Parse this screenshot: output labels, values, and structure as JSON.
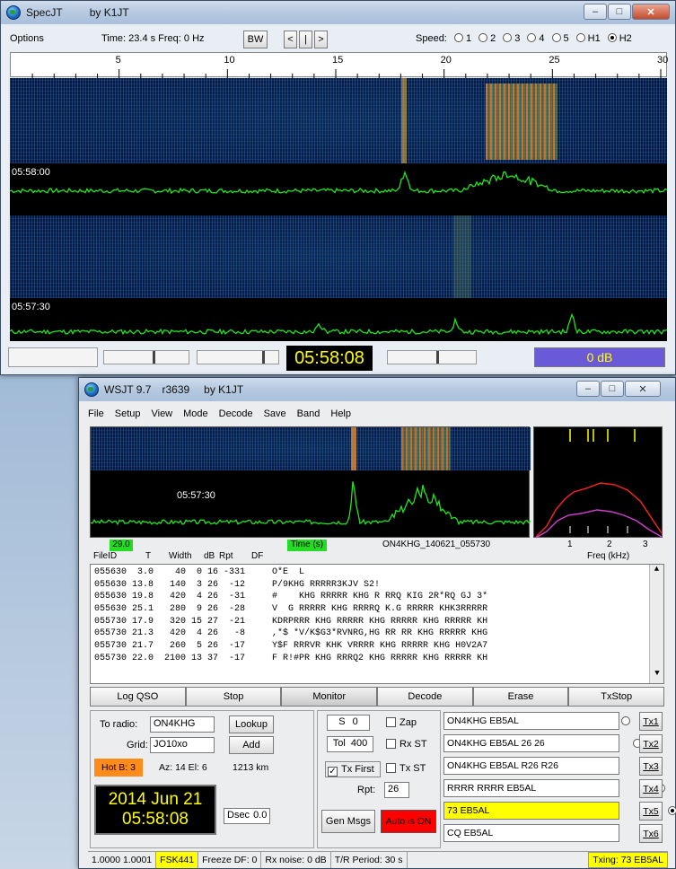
{
  "specjt": {
    "title": "SpecJT",
    "author": "by K1JT",
    "options_label": "Options",
    "time_readout": "Time: 23.4 s  Freq: 0 Hz",
    "bw_label": "BW",
    "nav_prev": "<",
    "nav_mid": "|",
    "nav_next": ">",
    "speed_label": "Speed:",
    "speed_options": [
      "1",
      "2",
      "3",
      "4",
      "5",
      "H1",
      "H2"
    ],
    "speed_selected": "H2",
    "scale_ticks": [
      "5",
      "10",
      "15",
      "20",
      "25",
      "30"
    ],
    "label_top": "05:58:00",
    "label_bottom": "05:57:30",
    "clock": "05:58:08",
    "db_readout": "0 dB"
  },
  "wsjt": {
    "title": "WSJT 9.7",
    "revision": "r3639",
    "author": "by K1JT",
    "menu": [
      "File",
      "Setup",
      "View",
      "Mode",
      "Decode",
      "Save",
      "Band",
      "Help"
    ],
    "plot_time_label": "05:57:30",
    "info_bar": {
      "value_left": "29.0",
      "time_label": "Time (s)",
      "filename": "ON4KHG_140621_055730",
      "freq_ticks": [
        "1",
        "2",
        "3"
      ],
      "freq_label": "Freq (kHz)"
    },
    "decode_header": [
      "FileID",
      "T",
      "Width",
      "dB",
      "Rpt",
      "DF"
    ],
    "decode_rows": [
      "055630  3.0    40  0 16 -331     O*E  L",
      "055630 13.8   140  3 26  -12     P/9KHG RRRRR3KJV S2!",
      "055630 19.8   420  4 26  -31     #    KHG RRRRR KHG R RRQ KIG 2R*RQ GJ 3*",
      "055630 25.1   280  9 26  -28     V  G RRRRR KHG RRRRQ K.G RRRRR KHK3RRRRR",
      "055730 17.9   320 15 27  -21     KDRPRRR KHG RRRRR KHG RRRRR KHG RRRRR KH",
      "055730 21.3   420  4 26   -8     ,*$ *V/K$G3*RVNRG,HG RR RR KHG RRRRR KHG",
      "055730 21.7   260  5 26  -17     Y$F RRRVR KHK VRRRR KHG RRRRR KHG H0V2A7",
      "055730 22.0  2100 13 37  -17     F R!#PR KHG RRRQ2 KHG RRRRR KHG RRRRR KH"
    ],
    "buttons": [
      "Log QSO",
      "Stop",
      "Monitor",
      "Decode",
      "Erase",
      "TxStop"
    ],
    "to_radio_label": "To radio:",
    "to_radio_value": "ON4KHG",
    "lookup_label": "Lookup",
    "grid_label": "Grid:",
    "grid_value": "JO10xo",
    "add_label": "Add",
    "hotb_label": "Hot B: 3",
    "az_el": "Az: 14   El: 6",
    "distance": "1213 km",
    "date": "2014 Jun 21",
    "time": "05:58:08",
    "dsec_label": "Dsec",
    "dsec_value": "0.0",
    "s_label": "S",
    "s_value": "0",
    "zap_label": "Zap",
    "tol_label": "Tol",
    "tol_value": "400",
    "rxst_label": "Rx ST",
    "txfirst_label": "Tx First",
    "txst_label": "Tx ST",
    "rpt_label": "Rpt:",
    "rpt_value": "26",
    "genmsgs_label": "Gen Msgs",
    "auto_label": "Auto is  ON",
    "tx_messages": [
      {
        "text": "ON4KHG EB5AL",
        "btn": "Tx1",
        "selected": false
      },
      {
        "text": "ON4KHG EB5AL 26 26",
        "btn": "Tx2",
        "selected": false
      },
      {
        "text": "ON4KHG EB5AL R26 R26",
        "btn": "Tx3",
        "selected": false
      },
      {
        "text": "RRRR RRRR EB5AL",
        "btn": "Tx4",
        "selected": false
      },
      {
        "text": "73 EB5AL",
        "btn": "Tx5",
        "selected": true
      },
      {
        "text": "CQ EB5AL",
        "btn": "Tx6",
        "selected": false
      }
    ],
    "status": {
      "ratio": "1.0000 1.0001",
      "mode": "FSK441",
      "freeze": "Freeze DF:   0",
      "rx_noise": "Rx noise:  0 dB",
      "tr_period": "T/R Period: 30 s",
      "txing": "Txing:  73 EB5AL"
    }
  },
  "colors": {
    "trace": "#22e51e",
    "yellow": "#ffff00",
    "red": "#ff0000",
    "orange": "#ff8c1a",
    "green_badge": "#22dd22",
    "clock_bg": "#000000",
    "clock_fg": "#ffff00"
  }
}
